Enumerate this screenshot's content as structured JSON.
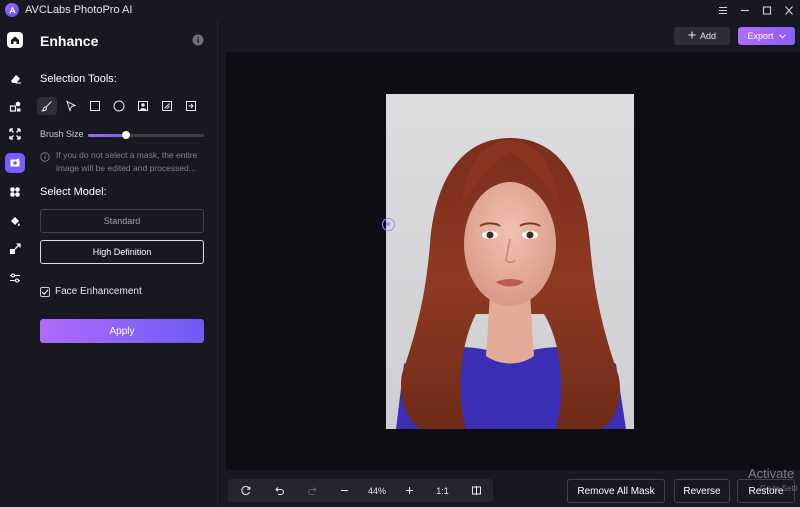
{
  "app": {
    "title": "AVCLabs PhotoPro AI"
  },
  "window_controls": [
    {
      "icon": "menu-icon"
    },
    {
      "icon": "minimize-icon"
    },
    {
      "icon": "maximize-icon"
    },
    {
      "icon": "close-icon"
    }
  ],
  "rail": {
    "items": [
      {
        "icon": "home-icon",
        "active": false
      },
      {
        "icon": "eraser-icon",
        "active": false
      },
      {
        "icon": "object-remove-icon",
        "active": false
      },
      {
        "icon": "expand-icon",
        "active": false
      },
      {
        "icon": "enhance-icon",
        "active": true
      },
      {
        "icon": "blur-icon",
        "active": false
      },
      {
        "icon": "colorize-icon",
        "active": false
      },
      {
        "icon": "upscale-icon",
        "active": false
      },
      {
        "icon": "adjust-icon",
        "active": false
      }
    ]
  },
  "panel": {
    "title": "Enhance",
    "selection_tools_label": "Selection Tools:",
    "tools": [
      {
        "icon": "brush-icon",
        "active": true
      },
      {
        "icon": "pointer-icon",
        "active": false
      },
      {
        "icon": "rectangle-select-icon",
        "active": false
      },
      {
        "icon": "ellipse-select-icon",
        "active": false
      },
      {
        "icon": "portrait-select-icon",
        "active": false
      },
      {
        "icon": "auto-select-icon",
        "active": false
      },
      {
        "icon": "import-mask-icon",
        "active": false
      }
    ],
    "brush_size_label": "Brush Size",
    "brush_size_fraction": 0.33,
    "hint": "If you do not select a mask, the entire image will be edited and processed...",
    "select_model_label": "Select Model:",
    "models": [
      {
        "label": "Standard",
        "selected": false
      },
      {
        "label": "High Definition",
        "selected": true
      }
    ],
    "face_enhancement": {
      "label": "Face Enhancement",
      "checked": true
    },
    "apply_label": "Apply"
  },
  "header": {
    "add_label": "Add",
    "export_label": "Export"
  },
  "bottom": {
    "zoom": "44%",
    "one_to_one": "1:1",
    "remove_all_mask_label": "Remove All Mask",
    "reverse_label": "Reverse",
    "restore_label": "Restore"
  },
  "watermark": {
    "text": "Activate",
    "sub": "Go to Setti"
  },
  "colors": {
    "accent": "#7b5cff",
    "apply_gradient_start": "#b06cf7",
    "apply_gradient_end": "#6d5af5",
    "background": "#16191f",
    "canvas": "#0c0e13"
  }
}
